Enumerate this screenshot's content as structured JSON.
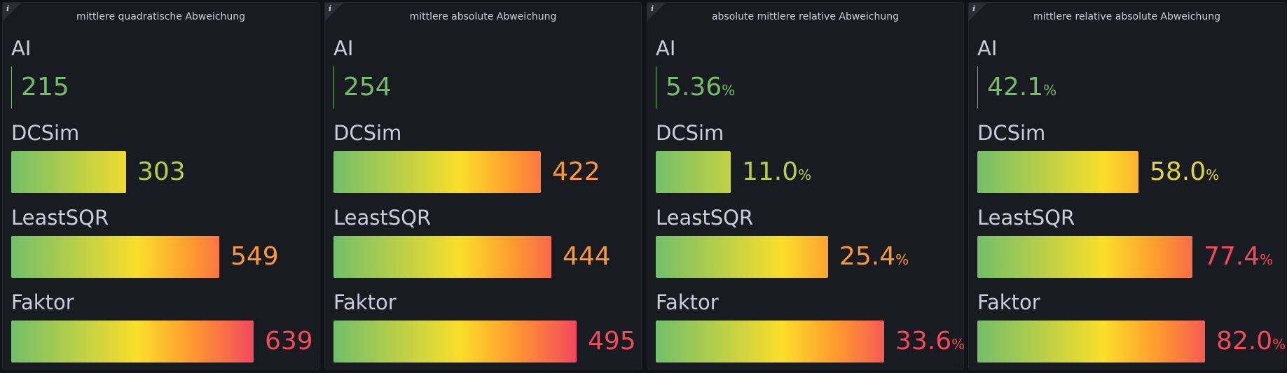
{
  "colors": {
    "green": "#73bf69",
    "yellow_green": "#b9cd4a",
    "yellow": "#fade2a",
    "orange": "#ff9830",
    "red": "#f2495c"
  },
  "panels": [
    {
      "title": "mittlere quadratische Abweichung",
      "info_icon": "i",
      "max": 639,
      "rows": [
        {
          "label": "AI",
          "value": 215,
          "display": "215",
          "unit": "",
          "color": "#73bf69"
        },
        {
          "label": "DCSim",
          "value": 303,
          "display": "303",
          "unit": "",
          "color": "#b9cd4a"
        },
        {
          "label": "LeastSQR",
          "value": 549,
          "display": "549",
          "unit": "",
          "color": "#ff9830"
        },
        {
          "label": "Faktor",
          "value": 639,
          "display": "639",
          "unit": "",
          "color": "#f2495c"
        }
      ]
    },
    {
      "title": "mittlere absolute Abweichung",
      "info_icon": "i",
      "max": 495,
      "rows": [
        {
          "label": "AI",
          "value": 254,
          "display": "254",
          "unit": "",
          "color": "#73bf69"
        },
        {
          "label": "DCSim",
          "value": 422,
          "display": "422",
          "unit": "",
          "color": "#ff9830"
        },
        {
          "label": "LeastSQR",
          "value": 444,
          "display": "444",
          "unit": "",
          "color": "#ff9830"
        },
        {
          "label": "Faktor",
          "value": 495,
          "display": "495",
          "unit": "",
          "color": "#f2495c"
        }
      ]
    },
    {
      "title": "absolute mittlere relative Abweichung",
      "info_icon": "i",
      "max": 33.6,
      "rows": [
        {
          "label": "AI",
          "value": 5.36,
          "display": "5.36",
          "unit": "%",
          "color": "#73bf69"
        },
        {
          "label": "DCSim",
          "value": 11.0,
          "display": "11.0",
          "unit": "%",
          "color": "#b9cd4a"
        },
        {
          "label": "LeastSQR",
          "value": 25.4,
          "display": "25.4",
          "unit": "%",
          "color": "#ff9830"
        },
        {
          "label": "Faktor",
          "value": 33.6,
          "display": "33.6",
          "unit": "%",
          "color": "#f2495c"
        }
      ]
    },
    {
      "title": "mittlere relative absolute Abweichung",
      "info_icon": "i",
      "max": 82.0,
      "rows": [
        {
          "label": "AI",
          "value": 42.1,
          "display": "42.1",
          "unit": "%",
          "color": "#73bf69"
        },
        {
          "label": "DCSim",
          "value": 58.0,
          "display": "58.0",
          "unit": "%",
          "color": "#e0d43a"
        },
        {
          "label": "LeastSQR",
          "value": 77.4,
          "display": "77.4",
          "unit": "%",
          "color": "#f2495c"
        },
        {
          "label": "Faktor",
          "value": 82.0,
          "display": "82.0",
          "unit": "%",
          "color": "#f2495c"
        }
      ]
    }
  ]
}
